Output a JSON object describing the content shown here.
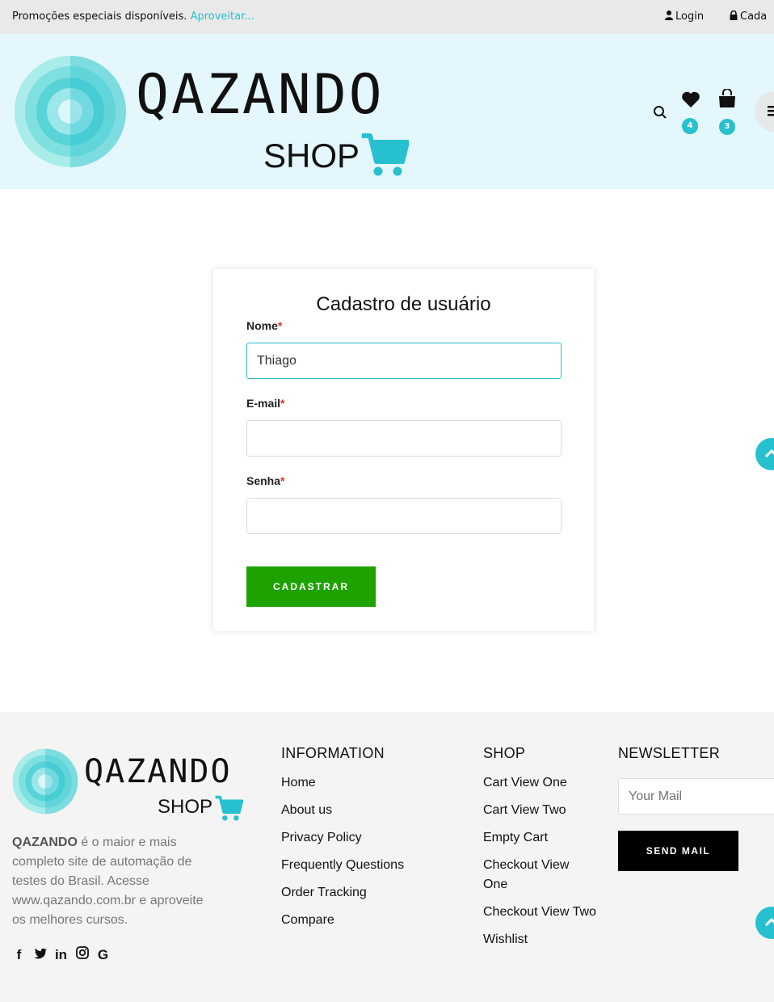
{
  "topbar": {
    "promo_text": "Promoções especiais disponíveis.",
    "promo_link": "Aproveitar...",
    "login": "Login",
    "cadastro": "Cada"
  },
  "header": {
    "logo_text": "QAZANDO",
    "logo_sub": "SHOP",
    "wishlist_count": "4",
    "cart_count": "3"
  },
  "form": {
    "title": "Cadastro de usuário",
    "name_label": "Nome",
    "name_value": "Thiago",
    "email_label": "E-mail",
    "email_value": "",
    "password_label": "Senha",
    "password_value": "",
    "required_mark": "*",
    "submit_label": "CADASTRAR"
  },
  "footer": {
    "logo_text": "QAZANDO",
    "logo_sub": "SHOP",
    "about_brand": "QAZANDO",
    "about_text": " é o maior e mais completo site de automação de testes do Brasil. Acesse www.qazando.com.br e aproveite os melhores cursos.",
    "information": {
      "title": "INFORMATION",
      "links": [
        "Home",
        "About us",
        "Privacy Policy",
        "Frequently Questions",
        "Order Tracking",
        "Compare"
      ]
    },
    "shop": {
      "title": "SHOP",
      "links": [
        "Cart View One",
        "Cart View Two",
        "Empty Cart",
        "Checkout View One",
        "Checkout View Two",
        "Wishlist"
      ]
    },
    "newsletter": {
      "title": "NEWSLETTER",
      "placeholder": "Your Mail",
      "button": "SEND MAIL"
    },
    "social": [
      "facebook-icon",
      "twitter-icon",
      "linkedin-icon",
      "instagram-icon",
      "google-icon"
    ]
  },
  "colors": {
    "accent": "#27c0cf",
    "header_bg": "#e3f7fc",
    "submit_bg": "#1ea200",
    "required": "#d9302c"
  }
}
